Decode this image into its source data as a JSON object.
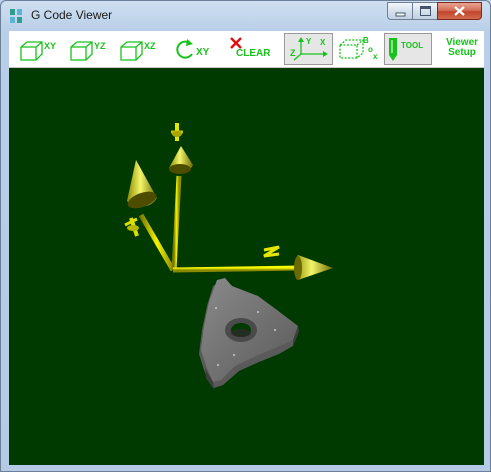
{
  "window": {
    "title": "G Code Viewer",
    "icon": "gcode-viewer-app-icon",
    "controls": [
      "minimize-icon",
      "maximize-icon",
      "close-icon"
    ]
  },
  "toolbar": {
    "view_xy": {
      "label": "XY",
      "icon": "cube-icon"
    },
    "view_yz": {
      "label": "YZ",
      "icon": "cube-icon"
    },
    "view_xz": {
      "label": "XZ",
      "icon": "cube-icon"
    },
    "rotate_xy": {
      "label": "XY",
      "icon": "rotate-icon"
    },
    "clear": {
      "label": "CLEAR",
      "icon": "x-icon"
    },
    "axes": {
      "labels": [
        "Y",
        "X",
        "Z"
      ],
      "icon": "axes-icon",
      "active": true
    },
    "box": {
      "labels": [
        "B",
        "o",
        "x"
      ],
      "icon": "box-icon",
      "active": false
    },
    "tool": {
      "label": "TOOL",
      "icon": "tool-icon",
      "active": true
    },
    "viewer_setup": {
      "line1": "Viewer",
      "line2": "Setup"
    }
  },
  "viewport": {
    "background": "#003a00",
    "axis_color": "#e8e800",
    "tool_color": "#6c6c6c",
    "content": "3D axis triad with threading insert tool"
  },
  "colors": {
    "toolbar_accent": "#17c21a",
    "clear_icon": "#e01010"
  }
}
